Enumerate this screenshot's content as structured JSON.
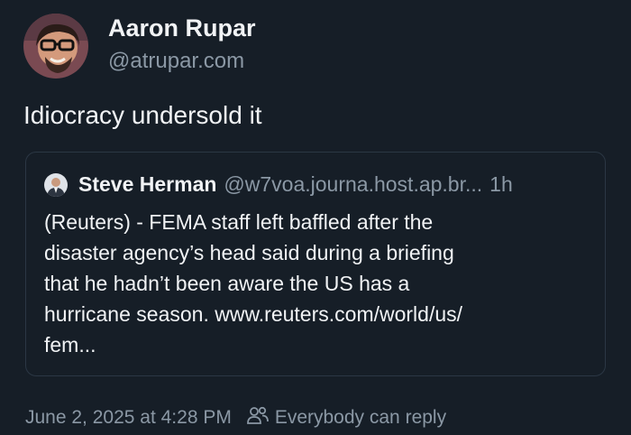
{
  "post": {
    "author_name": "Aaron Rupar",
    "author_handle": "@atrupar.com",
    "text": "Idiocracy undersold it",
    "avatar_icon": "user-avatar-photo"
  },
  "quote": {
    "author_name": "Steve Herman",
    "author_handle": "@w7voa.journa.host.ap.br...",
    "time": "1h",
    "lines": [
      "(Reuters) - FEMA staff left baffled after the",
      "disaster agency’s head said during a briefing",
      "that he hadn’t been aware the US has a",
      "hurricane season. www.reuters.com/world/us/",
      "fem..."
    ]
  },
  "footer": {
    "date": "June 2, 2025 at 4:28 PM",
    "reply_setting": "Everybody can reply",
    "icon": "people-icon"
  },
  "colors": {
    "background": "#161e27",
    "text": "#f1f3f5",
    "muted": "#8b98a5",
    "border": "#2b3744"
  }
}
